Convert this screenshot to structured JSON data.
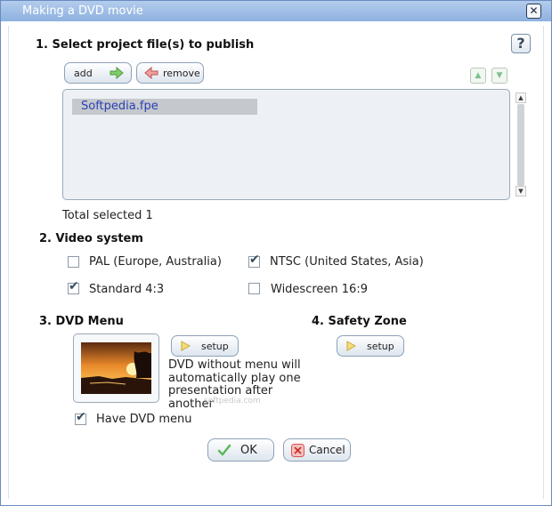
{
  "window": {
    "title": "Making a DVD movie"
  },
  "section1": {
    "heading": "1. Select project file(s) to publish",
    "add_label": "add",
    "remove_label": "remove",
    "files": [
      "Softpedia.fpe"
    ],
    "total_selected": "Total selected 1"
  },
  "section2": {
    "heading": "2. Video system",
    "options": [
      {
        "label": "PAL (Europe, Australia)",
        "checked": false
      },
      {
        "label": "NTSC (United States, Asia)",
        "checked": true
      },
      {
        "label": "Standard 4:3",
        "checked": true
      },
      {
        "label": "Widescreen 16:9",
        "checked": false
      }
    ]
  },
  "section3": {
    "heading": "3. DVD Menu",
    "setup_label": "setup",
    "description": "DVD without menu will automatically play one presentation after another",
    "have_menu_label": "Have DVD menu",
    "have_menu_checked": true
  },
  "section4": {
    "heading": "4. Safety Zone",
    "setup_label": "setup"
  },
  "footer": {
    "ok_label": "OK",
    "cancel_label": "Cancel"
  },
  "watermark": "softpedia.com",
  "colors": {
    "titlebar": "#9dbbe5",
    "selection_text": "#2b3fb5",
    "accent_green": "#5cb85c",
    "cancel_red": "#d9534f"
  }
}
